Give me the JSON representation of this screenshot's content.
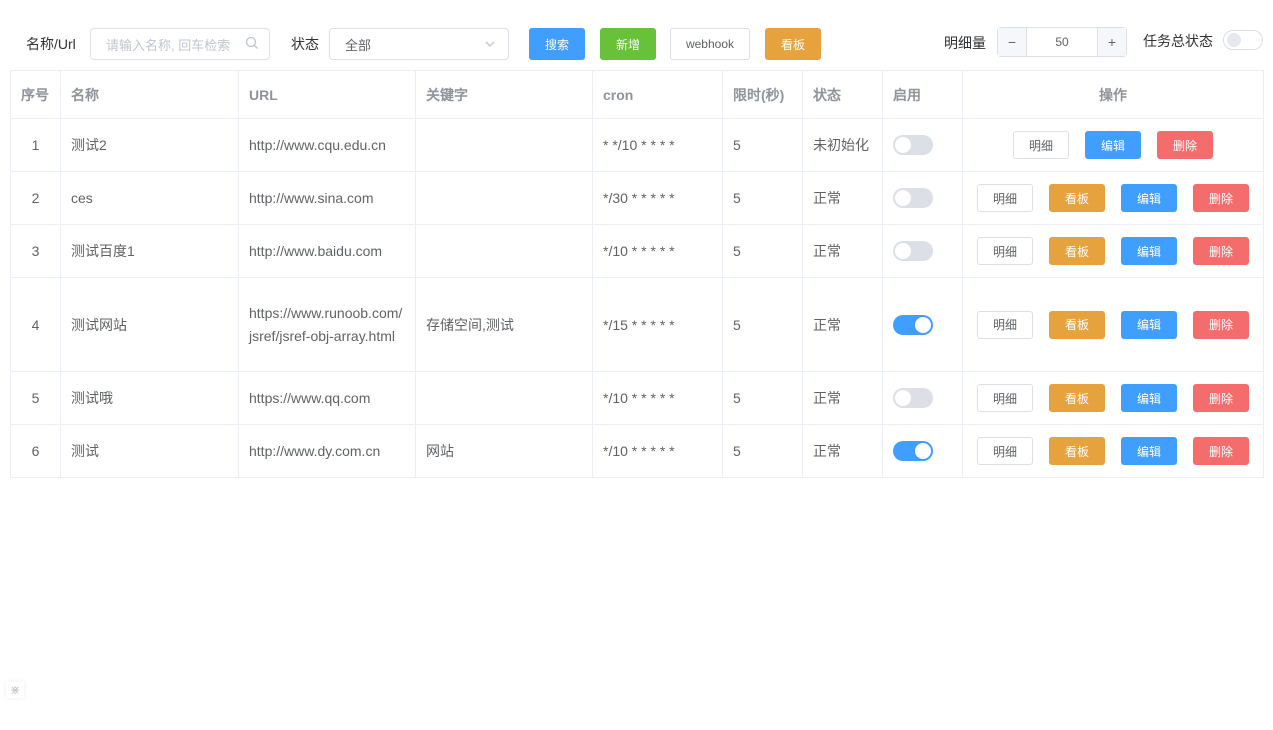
{
  "toolbar": {
    "search_label": "名称/Url",
    "search_placeholder": "请输入名称, 回车检索",
    "status_label": "状态",
    "status_value": "全部",
    "search_button": "搜索",
    "add_button": "新增",
    "webhook_button": "webhook",
    "board_button": "看板",
    "detail_count_label": "明细量",
    "detail_count_value": "50",
    "minus": "−",
    "plus": "+",
    "task_status_label": "任务总状态",
    "task_status_on": false
  },
  "table": {
    "headers": [
      "序号",
      "名称",
      "URL",
      "关键字",
      "cron",
      "限时(秒)",
      "状态",
      "启用",
      "操作"
    ],
    "action_labels": {
      "detail": "明细",
      "board": "看板",
      "edit": "编辑",
      "delete": "删除"
    },
    "rows": [
      {
        "index": "1",
        "name": "测试2",
        "url": "http://www.cqu.edu.cn",
        "keywords": "",
        "cron": "* */10 * * * *",
        "timeout": "5",
        "status": "未初始化",
        "status_ok": false,
        "enabled": false,
        "has_board": false
      },
      {
        "index": "2",
        "name": "ces",
        "url": "http://www.sina.com",
        "keywords": "",
        "cron": "*/30 * * * * *",
        "timeout": "5",
        "status": "正常",
        "status_ok": true,
        "enabled": false,
        "has_board": true
      },
      {
        "index": "3",
        "name": "测试百度1",
        "url": "http://www.baidu.com",
        "keywords": "",
        "cron": "*/10 * * * * *",
        "timeout": "5",
        "status": "正常",
        "status_ok": true,
        "enabled": false,
        "has_board": true
      },
      {
        "index": "4",
        "name": "测试网站",
        "url": "https://www.runoob.com/jsref/jsref-obj-array.html",
        "keywords": "存储空间,测试",
        "cron": "*/15 * * * * *",
        "timeout": "5",
        "status": "正常",
        "status_ok": true,
        "enabled": true,
        "has_board": true
      },
      {
        "index": "5",
        "name": "测试哦",
        "url": "https://www.qq.com",
        "keywords": "",
        "cron": "*/10 * * * * *",
        "timeout": "5",
        "status": "正常",
        "status_ok": true,
        "enabled": false,
        "has_board": true
      },
      {
        "index": "6",
        "name": "测试",
        "url": "http://www.dy.com.cn",
        "keywords": "网站",
        "cron": "*/10 * * * * *",
        "timeout": "5",
        "status": "正常",
        "status_ok": true,
        "enabled": true,
        "has_board": true
      }
    ]
  },
  "colors": {
    "primary": "#409eff",
    "success": "#67c23a",
    "warning": "#e6a23c",
    "danger": "#f56c6c"
  },
  "icons": {
    "search": "search-icon",
    "dropdown": "chevron-down-icon",
    "corner": "resize-handle-icon"
  }
}
